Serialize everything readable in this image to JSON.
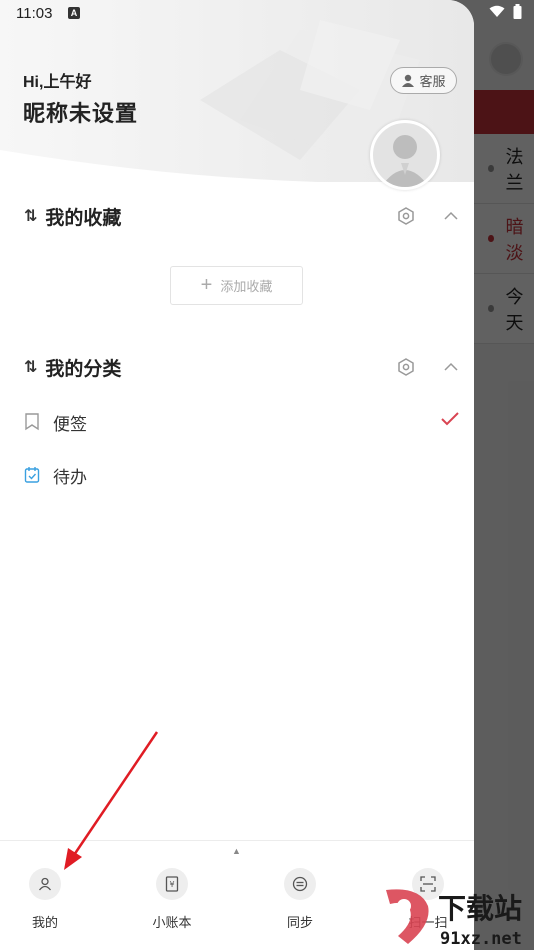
{
  "status_bar": {
    "time": "11:03",
    "indicator": "A"
  },
  "header": {
    "greeting": "Hi,上午好",
    "nickname": "昵称未设置",
    "service_button": "客服"
  },
  "favorites": {
    "title": "我的收藏",
    "sort_icon": "⇅",
    "add_label": "添加收藏"
  },
  "categories": {
    "title": "我的分类",
    "sort_icon": "⇅",
    "items": [
      {
        "label": "便签",
        "selected": true
      },
      {
        "label": "待办",
        "selected": false
      }
    ]
  },
  "bottom_nav": [
    {
      "label": "我的",
      "icon": "person-icon"
    },
    {
      "label": "小账本",
      "icon": "ledger-icon"
    },
    {
      "label": "同步",
      "icon": "sync-icon"
    },
    {
      "label": "扫一扫",
      "icon": "scan-icon"
    }
  ],
  "background_app": {
    "rows": [
      "法兰",
      "暗淡",
      "今天"
    ]
  },
  "watermark": {
    "text": "下载站",
    "url_text": "91xz.net"
  },
  "colors": {
    "accent": "#d94452",
    "todo_icon": "#3aa0e0",
    "background_bar": "#c9323a"
  }
}
